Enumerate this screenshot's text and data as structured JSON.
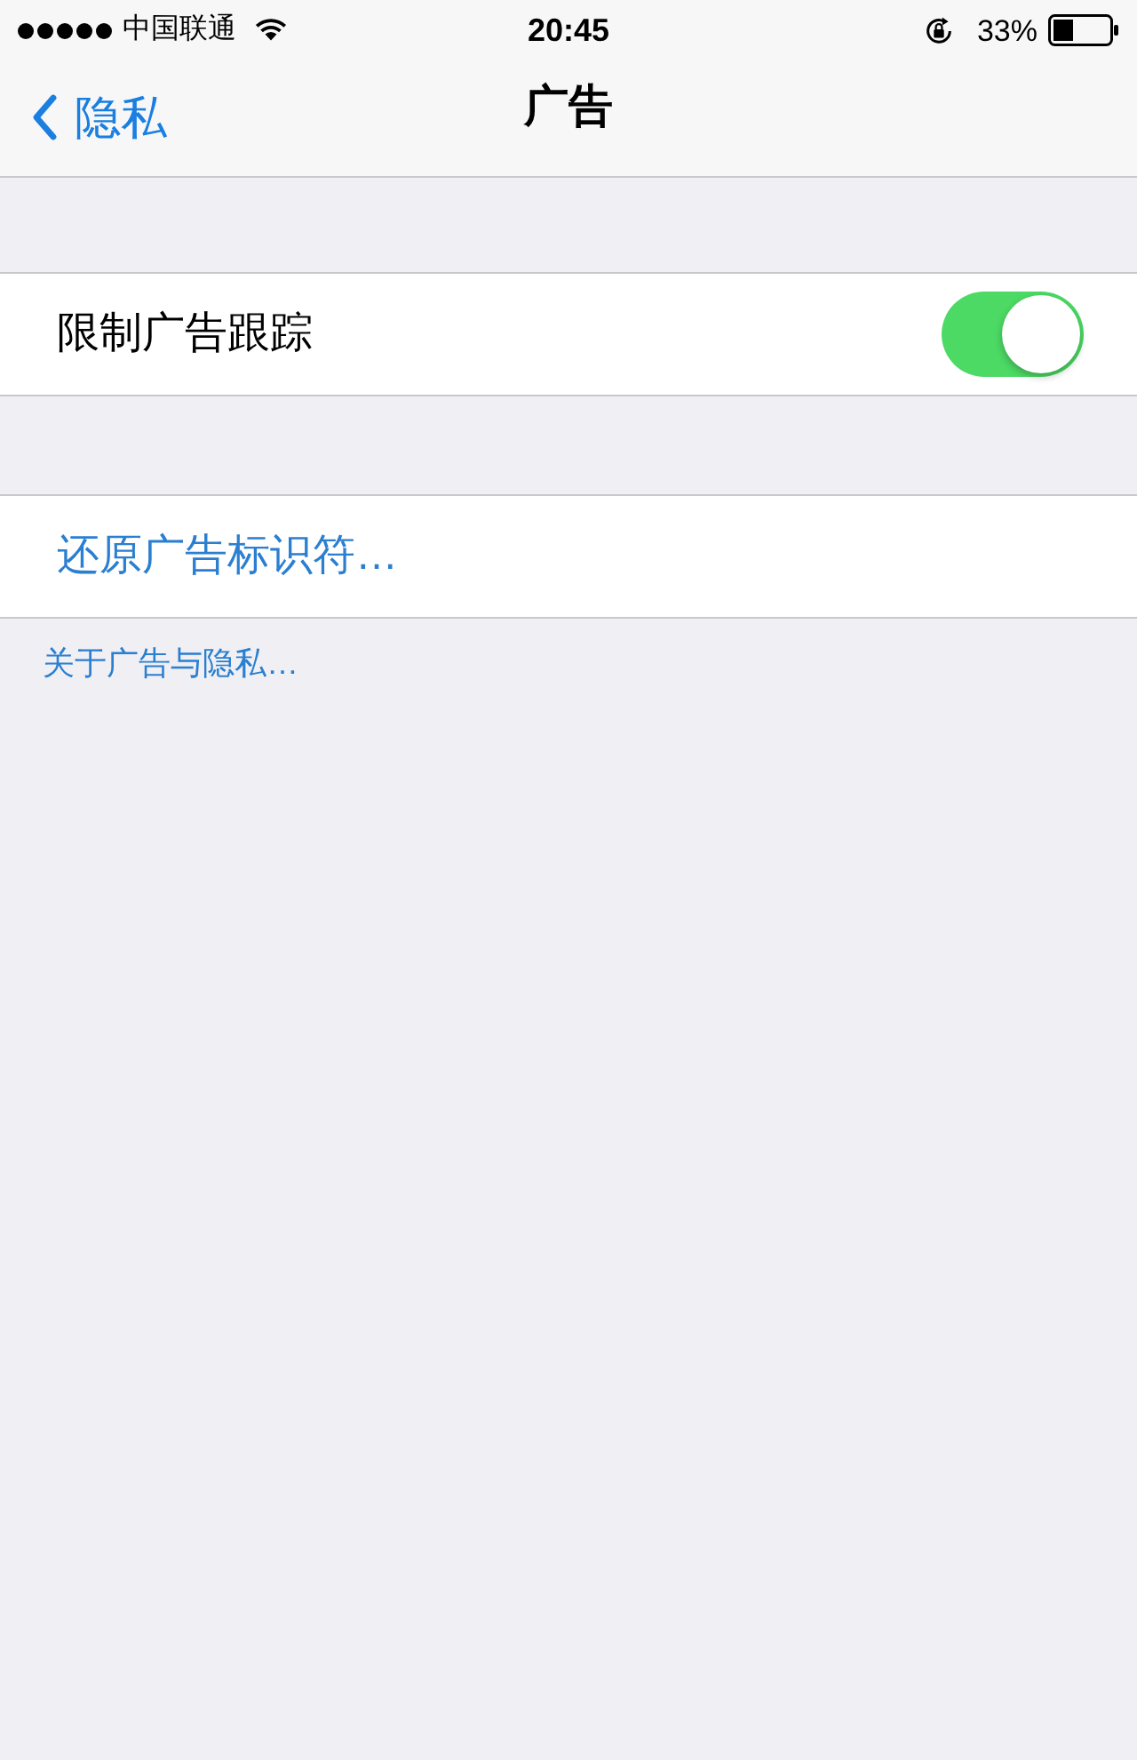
{
  "status_bar": {
    "carrier": "中国联通",
    "time": "20:45",
    "battery_percent": "33%"
  },
  "nav_bar": {
    "back_label": "隐私",
    "title": "广告"
  },
  "sections": [
    {
      "rows": [
        {
          "kind": "toggle",
          "label": "限制广告跟踪",
          "on": true
        }
      ]
    },
    {
      "rows": [
        {
          "kind": "action",
          "label": "还原广告标识符…"
        }
      ]
    }
  ],
  "footer_link": "关于广告与隐私…"
}
